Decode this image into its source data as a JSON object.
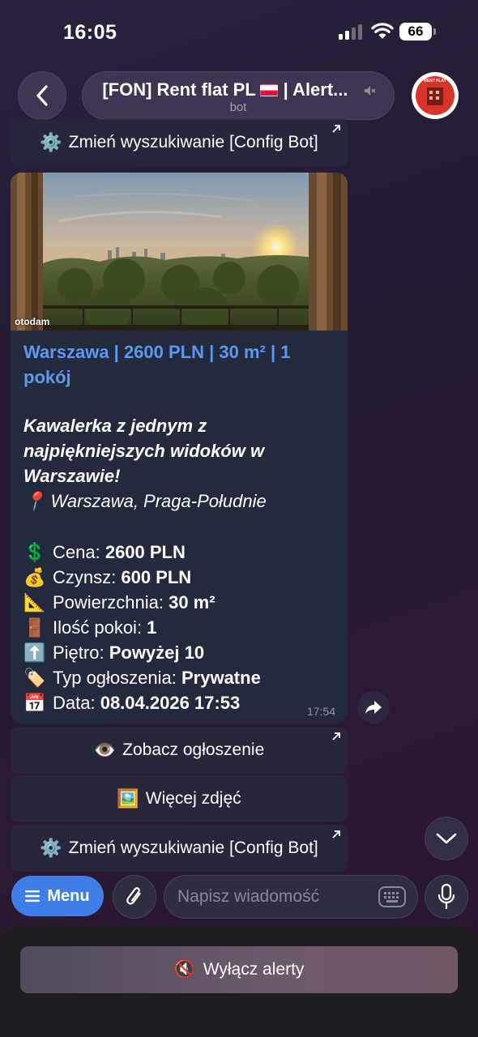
{
  "status_bar": {
    "time": "16:05",
    "battery": "66"
  },
  "header": {
    "title": "[FON] Rent flat PL",
    "title_suffix": "| Alert...",
    "subtitle": "bot",
    "avatar_text": "RENT FLAT"
  },
  "buttons": {
    "config_top": {
      "icon": "gear-icon",
      "label": "Zmień wyszukiwanie [Config Bot]"
    },
    "view_listing": {
      "icon": "eye-icon",
      "label": "Zobacz ogłoszenie"
    },
    "more_photos": {
      "icon": "picture-icon",
      "label": "Więcej zdjęć"
    },
    "config_bottom": {
      "icon": "gear-icon",
      "label": "Zmień wyszukiwanie [Config Bot]"
    }
  },
  "message": {
    "photo_watermark": "otodam",
    "link_title": "Warszawa | 2600 PLN | 30 m² | 1 pokój",
    "headline": "Kawalerka z jednym z najpiękniejszych widoków w Warszawie!",
    "location": "Warszawa, Praga-Południe",
    "details": [
      {
        "icon": "dollar-icon",
        "label": "Cena: ",
        "value": "2600 PLN"
      },
      {
        "icon": "money-bag-icon",
        "label": "Czynsz: ",
        "value": "600 PLN"
      },
      {
        "icon": "ruler-icon",
        "label": "Powierzchnia: ",
        "value": "30 m²"
      },
      {
        "icon": "door-icon",
        "label": "Ilość pokoi: ",
        "value": "1"
      },
      {
        "icon": "up-arrow-icon",
        "label": "Piętro: ",
        "value": "Powyżej 10"
      },
      {
        "icon": "tag-icon",
        "label": "Typ ogłoszenia: ",
        "value": "Prywatne"
      },
      {
        "icon": "calendar-icon",
        "label": "Data: ",
        "value": "08.04.2026 17:53"
      }
    ],
    "time": "17:54"
  },
  "input": {
    "menu_label": "Menu",
    "placeholder": "Napisz wiadomość"
  },
  "reply_keyboard": {
    "disable_alerts": "Wyłącz alerty"
  }
}
